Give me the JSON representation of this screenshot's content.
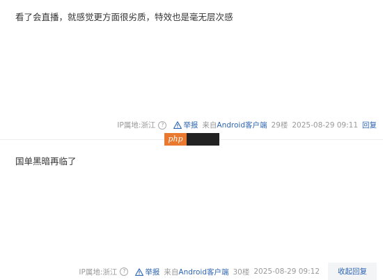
{
  "posts": [
    {
      "content": "看了会直播，就感觉更方面很劣质，特效也是毫无层次感",
      "ip_label": "IP属地:浙江",
      "report_label": "举报",
      "from_prefix": "来自",
      "from_client": "Android客户端",
      "floor": "29楼",
      "time": "2025-08-29 09:11",
      "action_label": "回复"
    },
    {
      "content": "国单黑暗再临了",
      "ip_label": "IP属地:浙江",
      "report_label": "举报",
      "from_prefix": "来自",
      "from_client": "Android客户端",
      "floor": "30楼",
      "time": "2025-08-29 09:12",
      "action_label": "收起回复"
    }
  ],
  "watermark": {
    "logo": "php"
  },
  "colors": {
    "link": "#2d64b3",
    "meta": "#999999",
    "text": "#333333",
    "watermark_logo": "#e8792e"
  },
  "icons": {
    "help": "help-circle-icon",
    "report": "warning-triangle-icon"
  }
}
